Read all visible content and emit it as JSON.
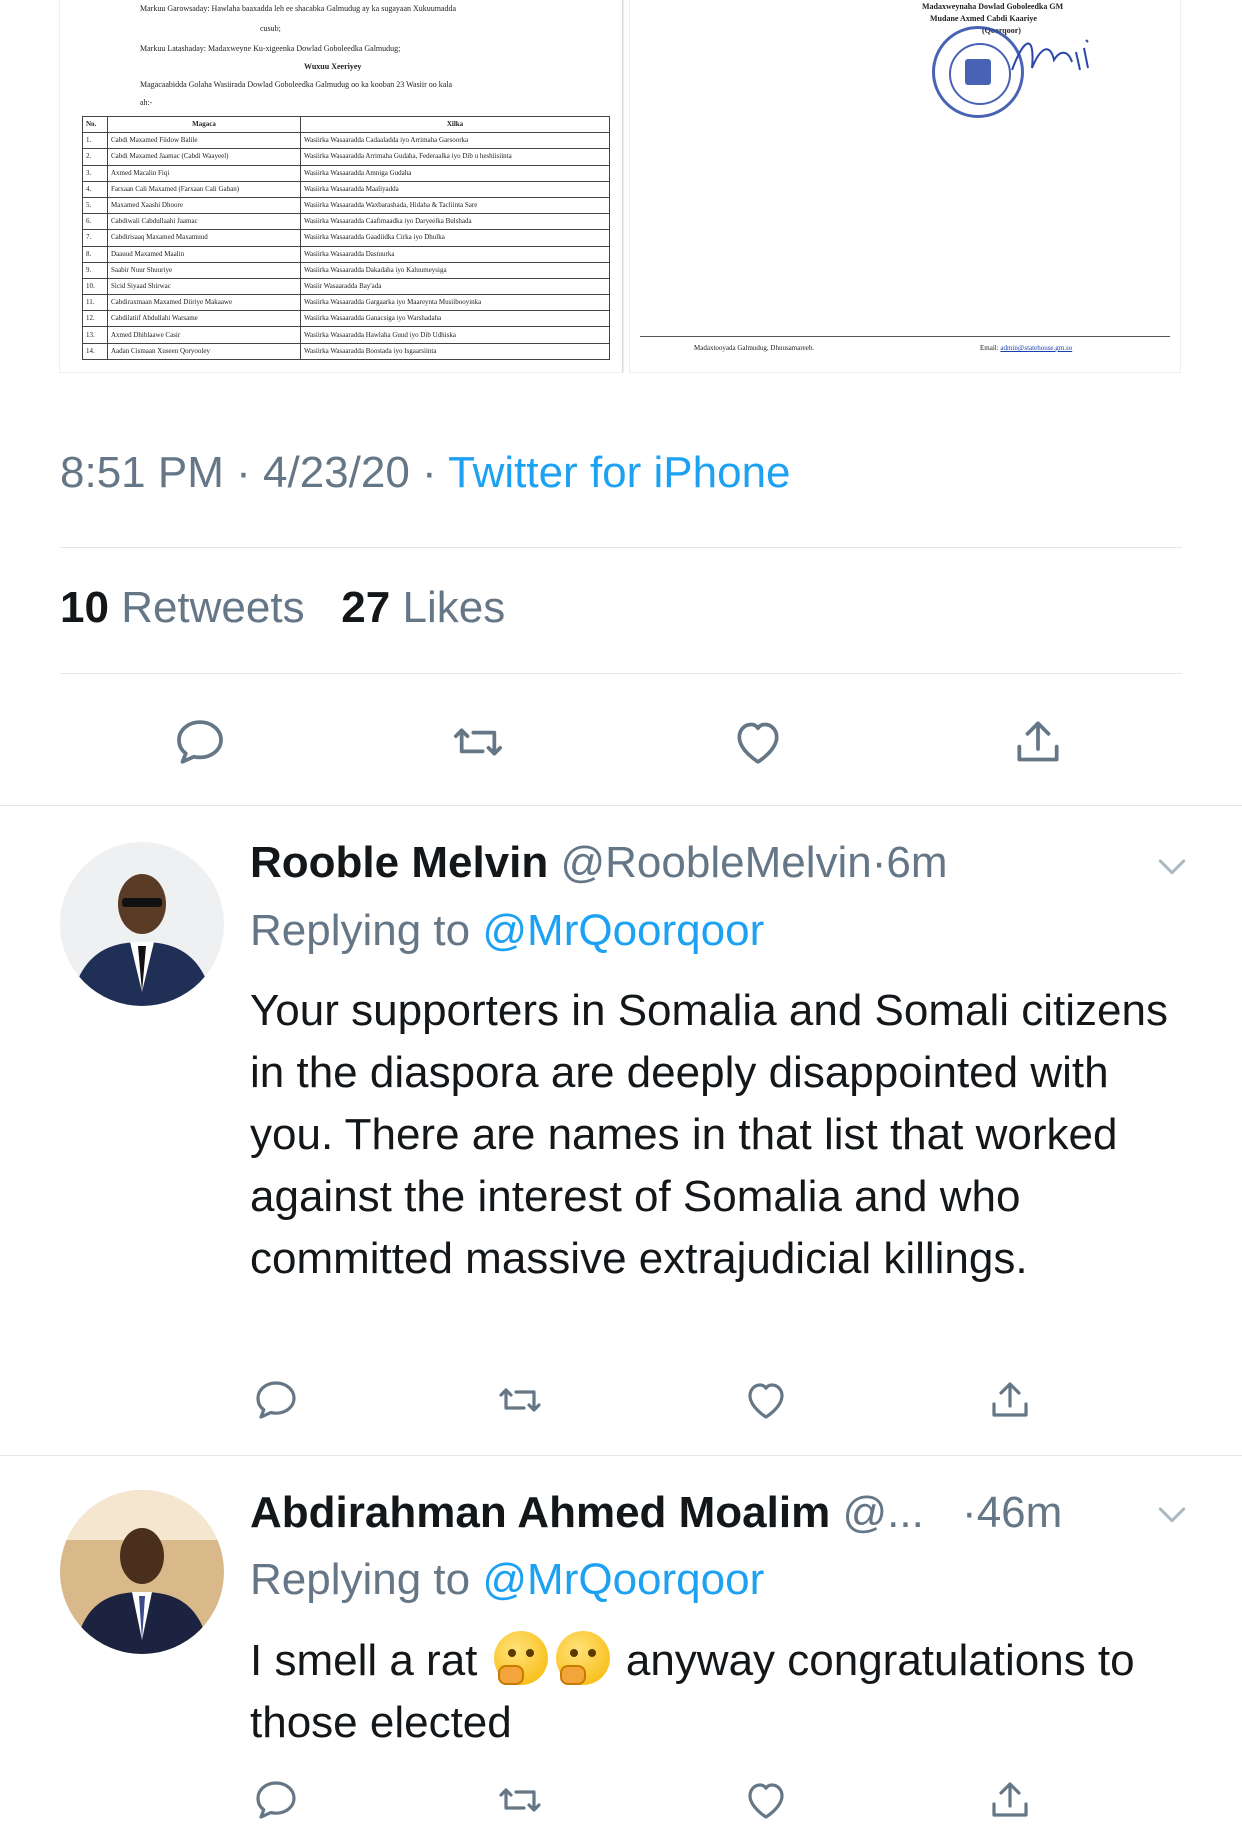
{
  "document_left": {
    "lines": [
      "Markuu Garowsaday: Hawlaha baaxadda leh ee shacabka Galmudug ay ka sugayaan Xukuumadda",
      "cusub;",
      "Markuu Latashaday:  Madaxweyne Ku-xigeenka Dowlad Goboleedka Galmudug;",
      "Wuxuu Xeeriyey",
      "Magacaabidda Golaha Wasiirada Dowlad Goboleedka Galmudug oo ka kooban 23 Wasiir oo kala",
      "ah:-"
    ],
    "table_headers": [
      "No.",
      "Magaca",
      "Xilka"
    ],
    "rows": [
      [
        "1.",
        "Cabdi Maxamed Fiidow Balile",
        "Wasiirka Wasaaradda Cadaaladda iyo Arrimaha Garsoorka"
      ],
      [
        "2.",
        "Cabdi Maxamed Jaamac (Cabdi Waayeel)",
        "Wasiirka Wasaaradda Arrimaha Gudaha, Federaalka iyo Dib u heshiisiinta"
      ],
      [
        "3.",
        "Axmed Macalin Fiqi",
        "Wasiirka Wasaaradda Amniga Gudaha"
      ],
      [
        "4.",
        "Farxaan Cali Maxamed (Farxaan Cali Gaban)",
        "Wasiirka Wasaaradda Maaliyadda"
      ],
      [
        "5.",
        "Maxamed Xaashi Dhoore",
        "Wasiirka Wasaaradda Waxbarashada, Hidaha & Tacliinta Sare"
      ],
      [
        "6.",
        "Cabdiwali Cabdullaahi Jaamac",
        "Wasiirka Wasaaradda Caafimaadka iyo Daryeelka Bulshada"
      ],
      [
        "7.",
        "Cabdirisaaq Maxamed Maxamuud",
        "Wasiirka Wasaaradda Gaadiidka Cirka iyo Dhulka"
      ],
      [
        "8.",
        "Daauud Maxamed Maalin",
        "Wasiirka Wasaaradda Dastuurka"
      ],
      [
        "9.",
        "Saabir Nuur Shuuriye",
        "Wasiirka Wasaaradda Dakadaha iyo Kaluumeysiga"
      ],
      [
        "10.",
        "Sicid Siyaad Shirwac",
        "Wasiir Wasaaradda Bay'ada"
      ],
      [
        "11.",
        "Cabdiraxmaan Maxamed Diiriye Makaawe",
        "Wasiirka Wasaaradda Gargaarka iyo Maareynta Musiibooyinka"
      ],
      [
        "12.",
        "Cabdilatiif Abdullahi Warsame",
        "Wasiirka Wasaaradda Ganacsiga iyo Warshadaha"
      ],
      [
        "13.",
        "Axmed Dhiblaawe Casir",
        "Wasiirka Wasaaradda Hawlaha Guud iyo Dib Udhiska"
      ],
      [
        "14.",
        "Aadan Cismaan Xuseen Qoryooley",
        "Wasiirka Wasaaradda Boostada iyo Isgaarsiinta"
      ]
    ]
  },
  "document_right": {
    "sign_title": "Madaxweynaha Dowlad Goboleedka GM",
    "sign_name": "Mudane Axmed Cabdi Kaariye",
    "sign_nick": "(Qoorqoor)",
    "footer_left": "Madaxtooyada Galmudug, Dhuusamareeb.",
    "footer_right_label": "Email: ",
    "footer_right_email": "admin@statehouse.gm.so"
  },
  "tweet_meta": {
    "time": "8:51 PM",
    "date": "4/23/20",
    "separator": "·",
    "source": "Twitter for iPhone"
  },
  "stats": {
    "retweets_count": "10",
    "retweets_label": "Retweets",
    "likes_count": "27",
    "likes_label": "Likes"
  },
  "replies": [
    {
      "name": "Rooble Melvin",
      "handle": "@RoobleMelvin",
      "dot": "·",
      "time": "6m",
      "replying_label": "Replying to",
      "replying_to": "@MrQoorqoor",
      "text": "Your supporters in Somalia and Somali citizens in the diaspora are deeply disappointed with you. There are names in that list that worked against the interest of Somalia and who committed massive extrajudicial killings."
    },
    {
      "name": "Abdirahman Ahmed Moalim",
      "handle": "@...",
      "dot": "·",
      "time": "46m",
      "replying_label": "Replying to",
      "replying_to": "@MrQoorqoor",
      "text_before_emoji": "I smell a rat",
      "text_after_emoji": "anyway congratulations to those elected",
      "emoji_names": [
        "thinking-face-emoji",
        "thinking-face-emoji"
      ]
    }
  ],
  "colors": {
    "text_primary": "#14171a",
    "text_secondary": "#657786",
    "link_blue": "#1da1f2",
    "divider": "#e1e8ed",
    "seal_blue": "#2a48a8"
  },
  "icons": [
    "reply-icon",
    "retweet-icon",
    "like-icon",
    "share-icon",
    "chevron-down-icon"
  ]
}
